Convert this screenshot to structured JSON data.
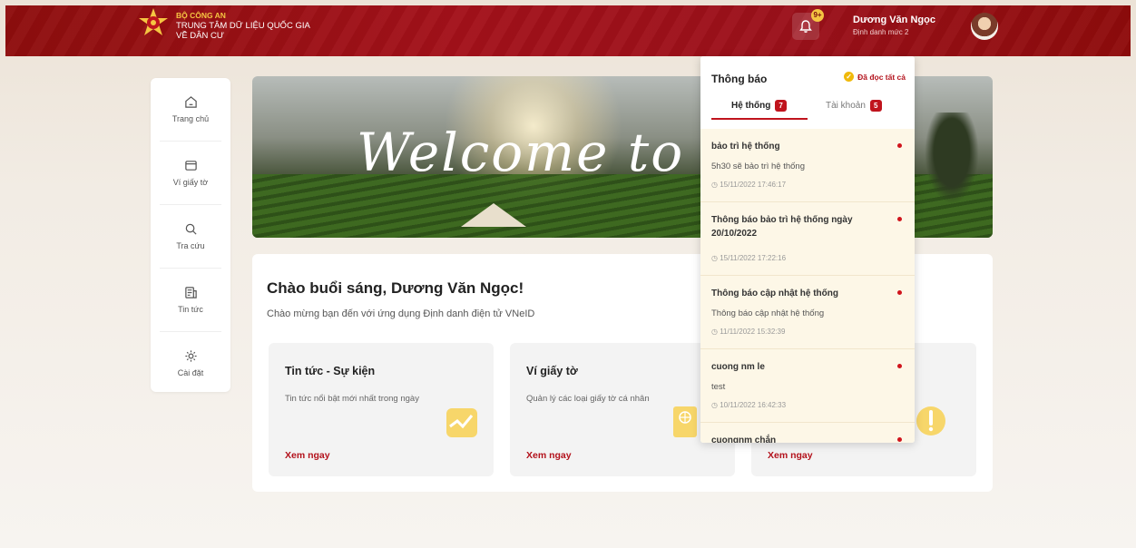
{
  "header": {
    "org_line1": "BỘ CÔNG AN",
    "org_line2": "TRUNG TÂM DỮ LIỆU QUỐC GIA",
    "org_line3": "VỀ DÂN CƯ",
    "bell_badge": "9+",
    "user_name": "Dương Văn Ngọc",
    "user_level": "Định danh mức 2"
  },
  "sidebar": {
    "items": [
      {
        "label": "Trang chủ",
        "icon": "home-icon"
      },
      {
        "label": "Ví giấy tờ",
        "icon": "wallet-icon"
      },
      {
        "label": "Tra cứu",
        "icon": "search-icon"
      },
      {
        "label": "Tin tức",
        "icon": "news-icon"
      },
      {
        "label": "Cài đặt",
        "icon": "gear-icon"
      }
    ]
  },
  "hero": {
    "title": "Welcome to V"
  },
  "main": {
    "greeting": "Chào buổi sáng, Dương Văn Ngọc!",
    "subtitle": "Chào mừng bạn đến với ứng dụng Định danh điện tử VNeID",
    "cards": [
      {
        "title": "Tin tức - Sự kiện",
        "desc": "Tin tức nổi bật mới nhất trong ngày",
        "link": "Xem ngay"
      },
      {
        "title": "Ví giấy tờ",
        "desc": "Quản lý các loại giấy tờ cá nhân",
        "link": "Xem ngay"
      },
      {
        "title": "",
        "desc": "",
        "link": "Xem ngay"
      }
    ]
  },
  "notifications": {
    "title": "Thông báo",
    "read_all": "Đã đọc tất cả",
    "tabs": [
      {
        "label": "Hệ thống",
        "count": "7"
      },
      {
        "label": "Tài khoản",
        "count": "5"
      }
    ],
    "items": [
      {
        "title": "bảo trì hệ thống",
        "body": "5h30 sẽ bảo trì hệ thống",
        "time": "15/11/2022 17:46:17"
      },
      {
        "title": "Thông báo bảo trì hệ thống ngày 20/10/2022",
        "body": "",
        "time": "15/11/2022 17:22:16"
      },
      {
        "title": "Thông báo cập nhật hệ thống",
        "body": "Thông báo cập nhật hệ thống",
        "time": "11/11/2022 15:32:39"
      },
      {
        "title": "cuong nm le",
        "body": "test",
        "time": "10/11/2022 16:42:33"
      },
      {
        "title": "cuongnm chắn",
        "body": "",
        "time": ""
      }
    ]
  },
  "colors": {
    "brand_red": "#a3111a",
    "accent_gold": "#f5c542",
    "link_red": "#b3121c"
  }
}
